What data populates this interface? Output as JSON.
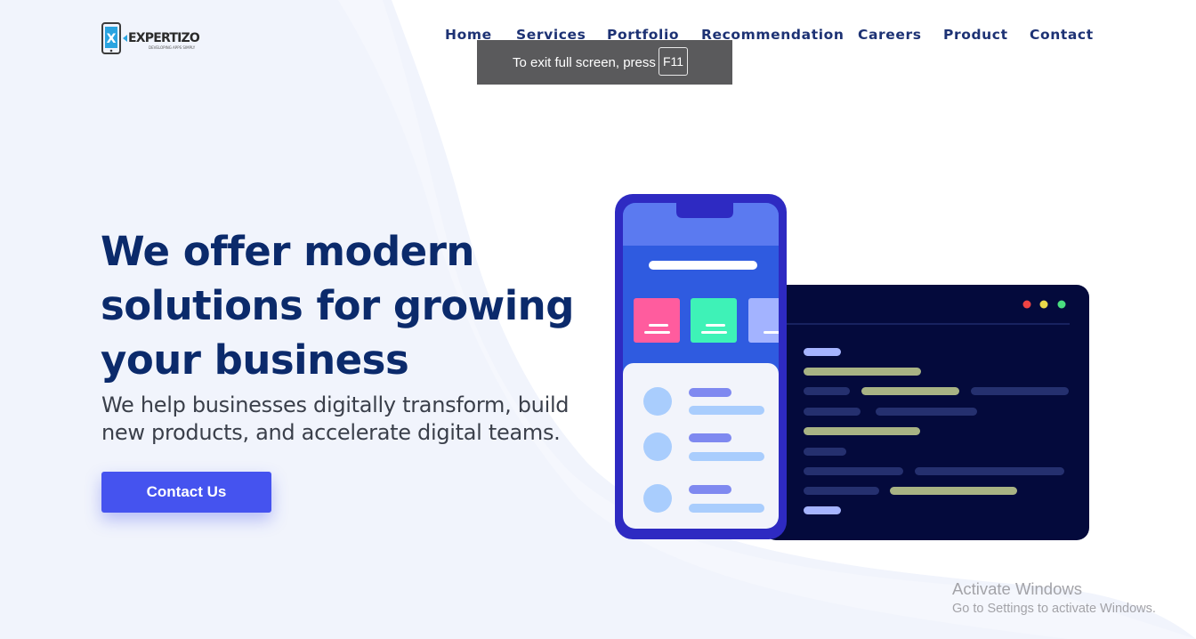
{
  "brand": {
    "logo_letter": "X",
    "logo_name": "EXPERTIZO",
    "logo_tagline": "DEVELOPING APPS SIMPLY",
    "colors": {
      "navy": "#0b2a6b",
      "nav_text": "#1d3274",
      "accent": "#4553ef",
      "logo_blue": "#2aa4e0"
    }
  },
  "nav": {
    "items": [
      {
        "label": "Home"
      },
      {
        "label": "Services"
      },
      {
        "label": "Portfolio"
      },
      {
        "label": "Recommendation"
      },
      {
        "label": "Careers"
      },
      {
        "label": "Product"
      },
      {
        "label": "Contact"
      }
    ]
  },
  "fullscreen_toast": {
    "message": "To exit full screen, press",
    "key": "F11"
  },
  "hero": {
    "title_lines": [
      "We offer modern",
      "solutions for growing",
      "your business"
    ],
    "subtitle_lines": [
      "We help businesses digitally transform, build",
      "new products, and accelerate digital teams."
    ],
    "cta_label": "Contact Us"
  },
  "illustration": {
    "name": "phone-and-code-window-illustration"
  },
  "watermark": {
    "title": "Activate Windows",
    "subtitle": "Go to Settings to activate Windows."
  }
}
